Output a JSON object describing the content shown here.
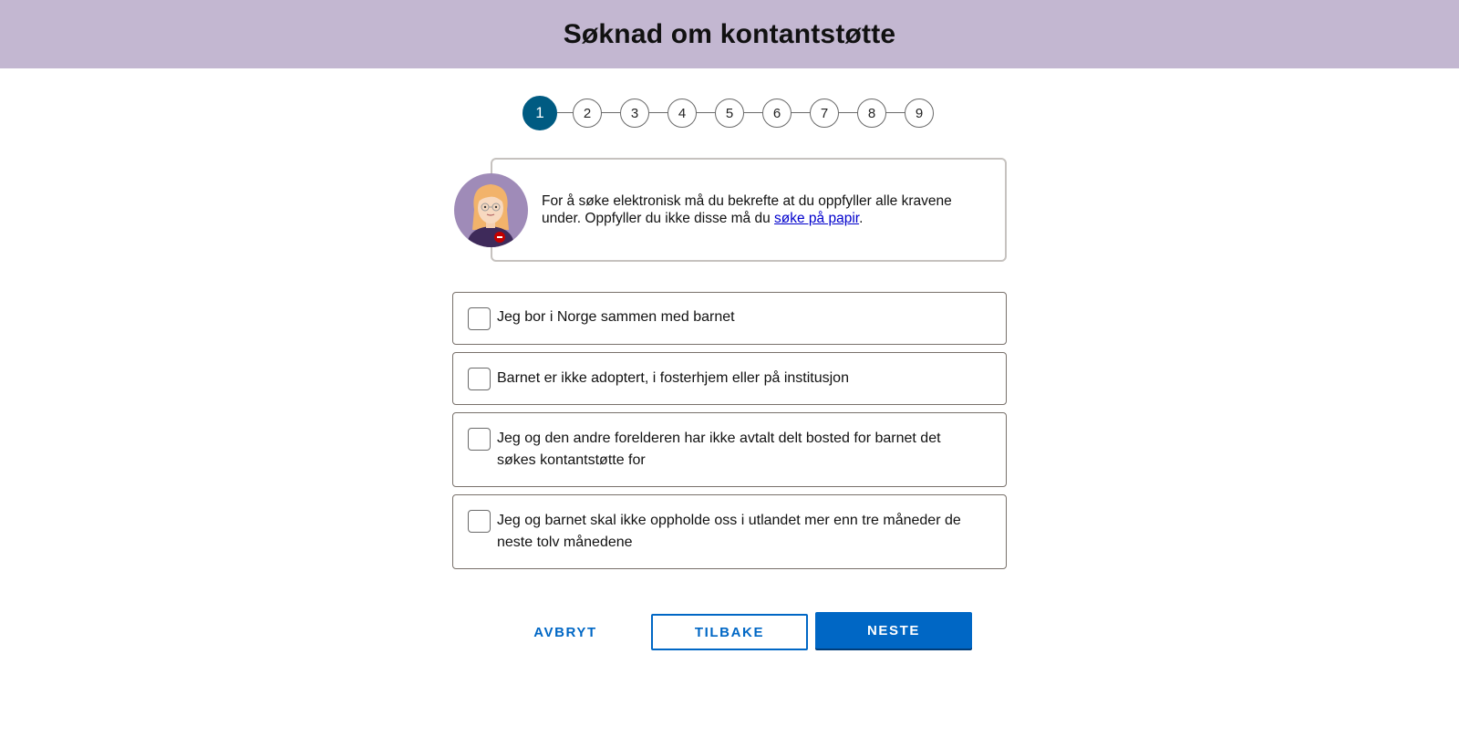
{
  "header": {
    "title": "Søknad om kontantstøtte"
  },
  "stepper": {
    "current": 1,
    "steps": [
      "1",
      "2",
      "3",
      "4",
      "5",
      "6",
      "7",
      "8",
      "9"
    ]
  },
  "info": {
    "text_before_link": "For å søke elektronisk må du bekrefte at du oppfyller alle kravene under. Oppfyller du ikke disse må du ",
    "link_text": "søke på papir",
    "text_after_link": ".",
    "avatar_icon": "veileder-avatar-icon"
  },
  "checklist": [
    {
      "label": "Jeg bor i Norge sammen med barnet",
      "checked": false
    },
    {
      "label": "Barnet er ikke adoptert, i fosterhjem eller på institusjon",
      "checked": false
    },
    {
      "label": "Jeg og den andre forelderen har ikke avtalt delt bosted for barnet det søkes kontantstøtte for",
      "checked": false
    },
    {
      "label": "Jeg og barnet skal ikke oppholde oss i utlandet mer enn tre måneder de neste tolv månedene",
      "checked": false
    }
  ],
  "buttons": {
    "cancel": "AVBRYT",
    "back": "TILBAKE",
    "next": "NESTE"
  },
  "colors": {
    "header_bg": "#c3b7d1",
    "step_active": "#005b82",
    "primary": "#0067c5",
    "avatar_bg": "#9f8bb8"
  }
}
